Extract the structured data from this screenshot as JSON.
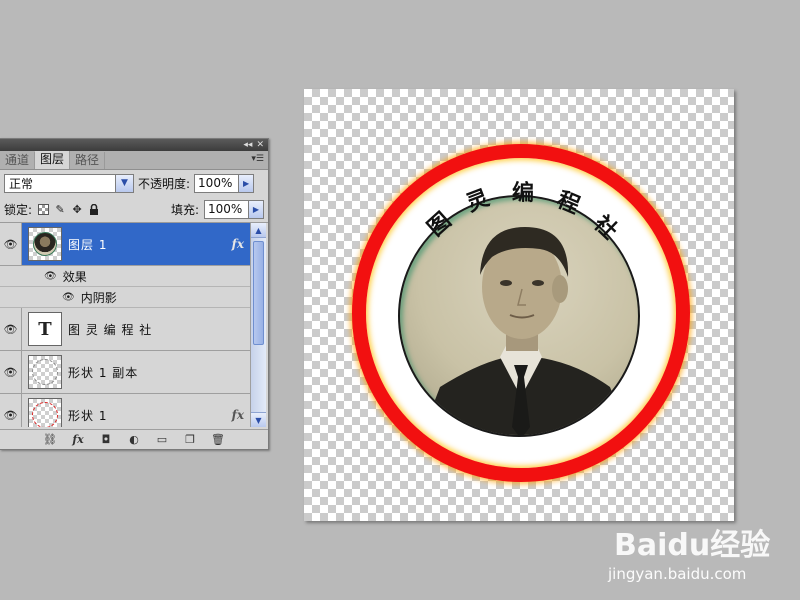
{
  "panel": {
    "tabs": [
      {
        "label": "通道"
      },
      {
        "label": "图层"
      },
      {
        "label": "路径"
      }
    ],
    "blend_mode": "正常",
    "opacity_label": "不透明度:",
    "opacity_value": "100%",
    "lock_label": "锁定:",
    "fill_label": "填充:",
    "fill_value": "100%",
    "layers": [
      {
        "name": "图层 1",
        "selected": true,
        "fx": "fx"
      },
      {
        "effects_label": "效果"
      },
      {
        "inner_shadow_label": "内阴影"
      },
      {
        "name": "图 灵 编 程 社",
        "thumb_text": "T"
      },
      {
        "name": "形状 1 副本"
      },
      {
        "name": "形状 1",
        "fx": "fx"
      }
    ],
    "bottom_icons": [
      "link-layers-icon",
      "fx-icon",
      "mask-icon",
      "adjustment-icon",
      "group-icon",
      "new-layer-icon",
      "trash-icon"
    ]
  },
  "canvas": {
    "arc_text": [
      "图",
      "灵",
      "编",
      "程",
      "社"
    ],
    "ring_color": "#f21010"
  },
  "watermark": {
    "logo": "Baidu经验",
    "url": "jingyan.baidu.com"
  }
}
